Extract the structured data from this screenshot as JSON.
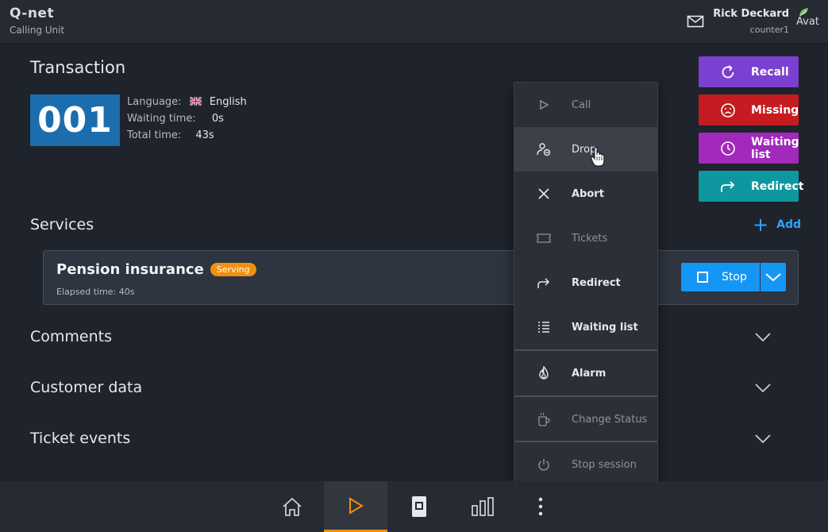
{
  "header": {
    "logo": "Q-net",
    "subtitle": "Calling Unit",
    "user_name": "Rick Deckard",
    "user_counter": "counter1",
    "avatar_alt": "Avat"
  },
  "transaction": {
    "title": "Transaction",
    "ticket_number": "001",
    "language_label": "Language:",
    "language_value": "English",
    "waiting_label": "Waiting time:",
    "waiting_value": "0s",
    "total_label": "Total time:",
    "total_value": "43s"
  },
  "actions": {
    "recall": "Recall",
    "missing": "Missing",
    "waiting_list": "Waiting list",
    "redirect": "Redirect"
  },
  "services": {
    "title": "Services",
    "add_label": "Add",
    "items": [
      {
        "name": "Pension insurance",
        "status": "Serving",
        "elapsed": "Elapsed time: 40s",
        "stop_label": "Stop"
      }
    ]
  },
  "sections": {
    "comments": "Comments",
    "customer_data": "Customer data",
    "ticket_events": "Ticket events"
  },
  "menu": {
    "items": [
      {
        "label": "Call",
        "icon": "play-icon",
        "enabled": false
      },
      {
        "label": "Drop",
        "icon": "user-remove-icon",
        "enabled": true,
        "hover": true
      },
      {
        "label": "Abort",
        "icon": "close-icon",
        "enabled": true
      },
      {
        "label": "Tickets",
        "icon": "ticket-icon",
        "enabled": false
      },
      {
        "label": "Redirect",
        "icon": "redirect-icon",
        "enabled": true
      },
      {
        "label": "Waiting list",
        "icon": "list-icon",
        "enabled": true
      },
      {
        "label": "Alarm",
        "icon": "flame-icon",
        "enabled": true
      },
      {
        "label": "Change Status",
        "icon": "coffee-icon",
        "enabled": false
      },
      {
        "label": "Stop session",
        "icon": "power-icon",
        "enabled": false
      }
    ]
  },
  "bottom_nav": {
    "items": [
      "home-icon",
      "play-icon",
      "ticket-icon",
      "stats-icon",
      "more-icon"
    ],
    "active": "play-icon"
  },
  "colors": {
    "recall": "#7b3fd1",
    "missing": "#c51c22",
    "waiting_list": "#a229bb",
    "redirect": "#0f979f",
    "ticket": "#1c6dae",
    "accent": "#1596f5",
    "serving_badge": "#f0900f",
    "active_nav": "#f0900f"
  }
}
